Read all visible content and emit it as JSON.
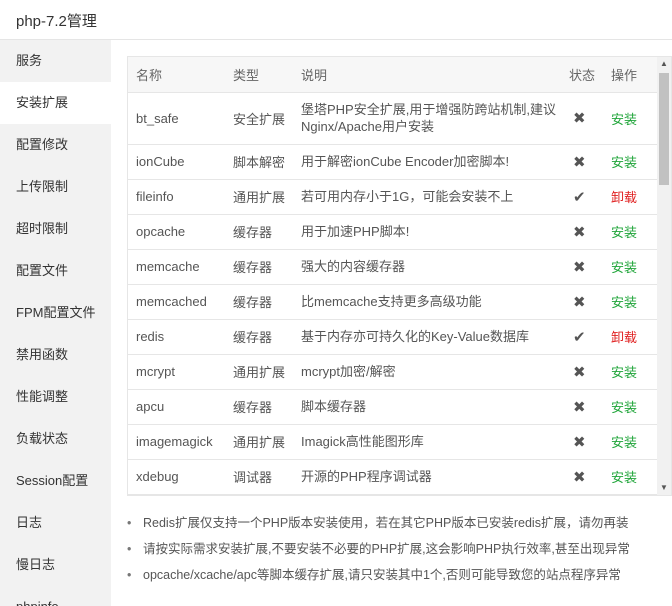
{
  "window": {
    "title": "php-7.2管理"
  },
  "sidebar": {
    "items": [
      {
        "label": "服务"
      },
      {
        "label": "安装扩展",
        "active": true
      },
      {
        "label": "配置修改"
      },
      {
        "label": "上传限制"
      },
      {
        "label": "超时限制"
      },
      {
        "label": "配置文件"
      },
      {
        "label": "FPM配置文件"
      },
      {
        "label": "禁用函数"
      },
      {
        "label": "性能调整"
      },
      {
        "label": "负载状态"
      },
      {
        "label": "Session配置"
      },
      {
        "label": "日志"
      },
      {
        "label": "慢日志"
      },
      {
        "label": "phpinfo"
      }
    ]
  },
  "table": {
    "headers": {
      "name": "名称",
      "type": "类型",
      "desc": "说明",
      "status": "状态",
      "action": "操作"
    },
    "rows": [
      {
        "name": "bt_safe",
        "type": "安全扩展",
        "desc": "堡塔PHP安全扩展,用于增强防跨站机制,建议Nginx/Apache用户安装",
        "installed": false,
        "status_icon": "✖",
        "action": "安装"
      },
      {
        "name": "ionCube",
        "type": "脚本解密",
        "desc": "用于解密ionCube Encoder加密脚本!",
        "installed": false,
        "status_icon": "✖",
        "action": "安装"
      },
      {
        "name": "fileinfo",
        "type": "通用扩展",
        "desc": "若可用内存小于1G，可能会安装不上",
        "installed": true,
        "status_icon": "✔",
        "action": "卸载"
      },
      {
        "name": "opcache",
        "type": "缓存器",
        "desc": "用于加速PHP脚本!",
        "installed": false,
        "status_icon": "✖",
        "action": "安装"
      },
      {
        "name": "memcache",
        "type": "缓存器",
        "desc": "强大的内容缓存器",
        "installed": false,
        "status_icon": "✖",
        "action": "安装"
      },
      {
        "name": "memcached",
        "type": "缓存器",
        "desc": "比memcache支持更多高级功能",
        "installed": false,
        "status_icon": "✖",
        "action": "安装"
      },
      {
        "name": "redis",
        "type": "缓存器",
        "desc": "基于内存亦可持久化的Key-Value数据库",
        "installed": true,
        "status_icon": "✔",
        "action": "卸载"
      },
      {
        "name": "mcrypt",
        "type": "通用扩展",
        "desc": "mcrypt加密/解密",
        "installed": false,
        "status_icon": "✖",
        "action": "安装"
      },
      {
        "name": "apcu",
        "type": "缓存器",
        "desc": "脚本缓存器",
        "installed": false,
        "status_icon": "✖",
        "action": "安装"
      },
      {
        "name": "imagemagick",
        "type": "通用扩展",
        "desc": "Imagick高性能图形库",
        "installed": false,
        "status_icon": "✖",
        "action": "安装"
      },
      {
        "name": "xdebug",
        "type": "调试器",
        "desc": "开源的PHP程序调试器",
        "installed": false,
        "status_icon": "✖",
        "action": "安装"
      }
    ]
  },
  "notes": [
    "Redis扩展仅支持一个PHP版本安装使用，若在其它PHP版本已安装redis扩展，请勿再装",
    "请按实际需求安装扩展,不要安装不必要的PHP扩展,这会影响PHP执行效率,甚至出现异常",
    "opcache/xcache/apc等脚本缓存扩展,请只安装其中1个,否则可能导致您的站点程序异常"
  ],
  "colors": {
    "install": "#20a53a",
    "uninstall": "#e02020",
    "sidebar_bg": "#f2f2f2"
  }
}
